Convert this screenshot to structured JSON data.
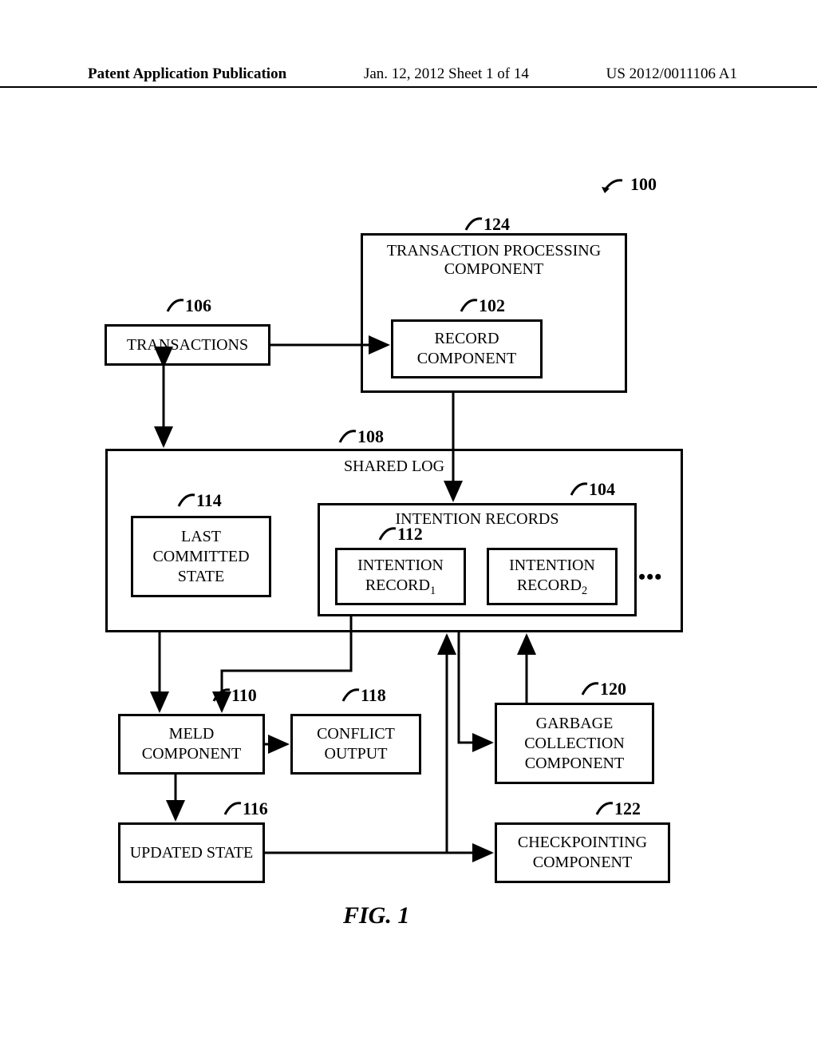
{
  "header": {
    "left": "Patent Application Publication",
    "center": "Jan. 12, 2012  Sheet 1 of 14",
    "right": "US 2012/0011106 A1"
  },
  "refs": {
    "r100": "100",
    "r102": "102",
    "r104": "104",
    "r106": "106",
    "r108": "108",
    "r110": "110",
    "r112": "112",
    "r114": "114",
    "r116": "116",
    "r118": "118",
    "r120": "120",
    "r122": "122",
    "r124": "124"
  },
  "boxes": {
    "tpc": "TRANSACTION PROCESSING COMPONENT",
    "record": "RECORD COMPONENT",
    "transactions": "TRANSACTIONS",
    "shared_log": "SHARED LOG",
    "intention_records": "INTENTION RECORDS",
    "last_committed": "LAST COMMITTED STATE",
    "ir1_a": "INTENTION",
    "ir1_b": "RECORD",
    "ir1_sub": "1",
    "ir2_a": "INTENTION",
    "ir2_b": "RECORD",
    "ir2_sub": "2",
    "meld": "MELD COMPONENT",
    "conflict": "CONFLICT OUTPUT",
    "garbage": "GARBAGE COLLECTION COMPONENT",
    "updated": "UPDATED STATE",
    "checkpointing": "CHECKPOINTING COMPONENT"
  },
  "figure_label": "FIG. 1",
  "ellipsis": "•••"
}
